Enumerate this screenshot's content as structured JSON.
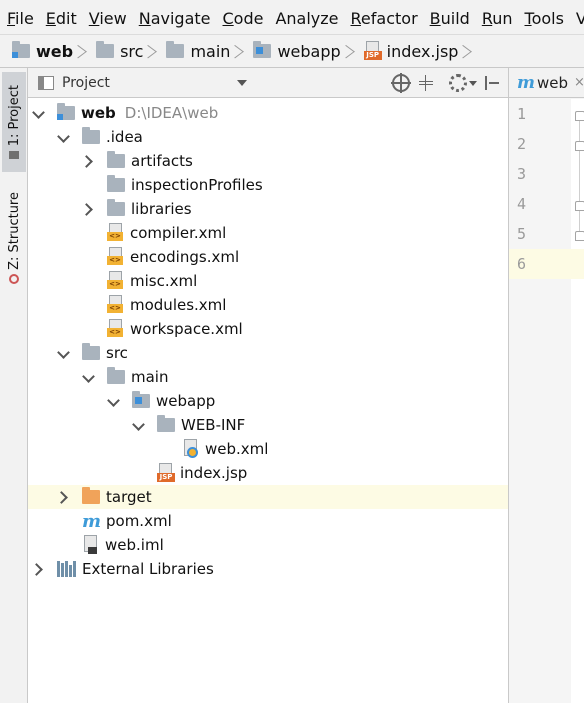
{
  "menubar": {
    "items": [
      {
        "mnemonic": "F",
        "rest": "ile"
      },
      {
        "mnemonic": "E",
        "rest": "dit"
      },
      {
        "mnemonic": "V",
        "rest": "iew"
      },
      {
        "mnemonic": "N",
        "rest": "avigate"
      },
      {
        "mnemonic": "C",
        "rest": "ode"
      },
      {
        "mnemonic": "",
        "rest": "Analyze"
      },
      {
        "mnemonic": "R",
        "rest": "efactor"
      },
      {
        "mnemonic": "B",
        "rest": "uild"
      },
      {
        "mnemonic": "R",
        "rest": "un"
      },
      {
        "mnemonic": "T",
        "rest": "ools"
      },
      {
        "mnemonic": "",
        "rest": "VC"
      }
    ]
  },
  "breadcrumb": {
    "items": [
      "web",
      "src",
      "main",
      "webapp",
      "index.jsp"
    ]
  },
  "toolstrip": {
    "project_tab": "1: Project",
    "structure_tab": "Z: Structure"
  },
  "project_panel": {
    "title": "Project",
    "tree": [
      {
        "depth": 0,
        "arrow": "down",
        "icon": "module-folder-icon",
        "label": "web",
        "path": "D:\\IDEA\\web",
        "bold": true
      },
      {
        "depth": 1,
        "arrow": "down",
        "icon": "folder-icon",
        "label": ".idea"
      },
      {
        "depth": 2,
        "arrow": "right",
        "icon": "folder-icon",
        "label": "artifacts"
      },
      {
        "depth": 2,
        "arrow": "none",
        "icon": "folder-icon",
        "label": "inspectionProfiles"
      },
      {
        "depth": 2,
        "arrow": "right",
        "icon": "folder-icon",
        "label": "libraries"
      },
      {
        "depth": 2,
        "arrow": "none",
        "icon": "xml-file-icon",
        "label": "compiler.xml"
      },
      {
        "depth": 2,
        "arrow": "none",
        "icon": "xml-file-icon",
        "label": "encodings.xml"
      },
      {
        "depth": 2,
        "arrow": "none",
        "icon": "xml-file-icon",
        "label": "misc.xml"
      },
      {
        "depth": 2,
        "arrow": "none",
        "icon": "xml-file-icon",
        "label": "modules.xml"
      },
      {
        "depth": 2,
        "arrow": "none",
        "icon": "xml-file-icon",
        "label": "workspace.xml"
      },
      {
        "depth": 1,
        "arrow": "down",
        "icon": "folder-icon",
        "label": "src"
      },
      {
        "depth": 2,
        "arrow": "down",
        "icon": "folder-icon",
        "label": "main"
      },
      {
        "depth": 3,
        "arrow": "down",
        "icon": "web-folder-icon",
        "label": "webapp"
      },
      {
        "depth": 4,
        "arrow": "down",
        "icon": "folder-icon",
        "label": "WEB-INF"
      },
      {
        "depth": 5,
        "arrow": "none",
        "icon": "web-xml-file-icon",
        "label": "web.xml"
      },
      {
        "depth": 4,
        "arrow": "none",
        "icon": "jsp-file-icon",
        "label": "index.jsp"
      },
      {
        "depth": 1,
        "arrow": "right",
        "icon": "excluded-folder-icon",
        "label": "target",
        "highlight": true
      },
      {
        "depth": 1,
        "arrow": "none",
        "icon": "maven-icon",
        "label": "pom.xml"
      },
      {
        "depth": 1,
        "arrow": "none",
        "icon": "iml-file-icon",
        "label": "web.iml"
      },
      {
        "depth": 0,
        "arrow": "right",
        "icon": "libraries-icon",
        "label": "External Libraries"
      }
    ]
  },
  "editor": {
    "tab_label": "web",
    "tab_close": "×",
    "line_numbers": [
      "1",
      "2",
      "3",
      "4",
      "5",
      "6"
    ]
  },
  "colors": {
    "chrome_bg": "#f2f2f2",
    "highlight_row": "#fdfbe4",
    "folder_gray": "#a9b3bd",
    "excluded_orange": "#f0a35a",
    "maven_blue": "#3e9bd8"
  }
}
